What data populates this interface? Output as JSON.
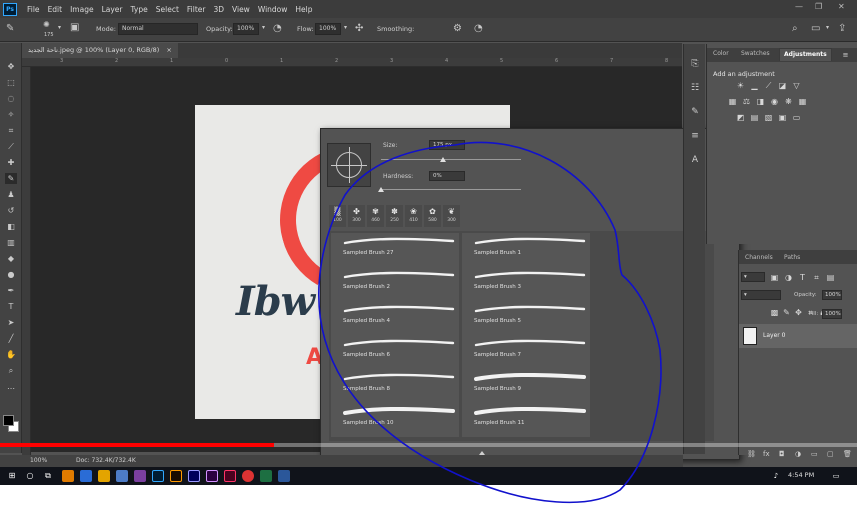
{
  "app": {
    "logo": "Ps",
    "menu": [
      "File",
      "Edit",
      "Image",
      "Layer",
      "Type",
      "Select",
      "Filter",
      "3D",
      "View",
      "Window",
      "Help"
    ]
  },
  "options_bar": {
    "brush_size": "175",
    "mode_label": "Mode:",
    "mode_value": "Normal",
    "opacity_label": "Opacity:",
    "opacity_value": "100%",
    "flow_label": "Flow:",
    "flow_value": "100%",
    "smoothing_label": "Smoothing:"
  },
  "document": {
    "tab_title": "ناحة الجديد.jpeg @ 100% (Layer 0, RGB/8)",
    "tab_close": "×",
    "ruler_numbers": [
      "3",
      "2",
      "1",
      "0",
      "1",
      "2",
      "3",
      "4",
      "5",
      "6",
      "7",
      "8"
    ],
    "logo_text": "Ibw",
    "logo_sub": "A"
  },
  "brush_picker": {
    "size_label": "Size:",
    "size_value": "175 px",
    "hardness_label": "Hardness:",
    "hardness_value": "0%",
    "size_level": 0.44,
    "hardness_level": 0.0,
    "tips": [
      "100",
      "300",
      "460",
      "250",
      "410",
      "580",
      "300"
    ],
    "brushes": [
      {
        "name": "Sampled Brush 27"
      },
      {
        "name": "Sampled Brush 1"
      },
      {
        "name": "Sampled Brush 2"
      },
      {
        "name": "Sampled Brush 3"
      },
      {
        "name": "Sampled Brush 4"
      },
      {
        "name": "Sampled Brush 5"
      },
      {
        "name": "Sampled Brush 6"
      },
      {
        "name": "Sampled Brush 7"
      },
      {
        "name": "Sampled Brush 8"
      },
      {
        "name": "Sampled Brush 9"
      },
      {
        "name": "Sampled Brush 10"
      },
      {
        "name": "Sampled Brush 11"
      }
    ]
  },
  "panels": {
    "top_tabs": [
      "Color",
      "Swatches",
      "Adjustments"
    ],
    "active_top_tab": "Adjustments",
    "adjustments_title": "Add an adjustment",
    "layer_tabs": [
      "Channels",
      "Paths"
    ],
    "opacity_label": "Opacity:",
    "opacity_value": "100%",
    "fill_label": "Fill:",
    "fill_value": "100%",
    "layer_name": "Layer 0"
  },
  "status": {
    "zoom": "100%",
    "doc": "Doc: 732.4K/732.4K"
  },
  "video": {
    "progress": 0.32
  },
  "taskbar": {
    "time": "4:54 PM"
  },
  "colors": {
    "accent_red": "#ef4a43",
    "logo_navy": "#2b3c4b",
    "annotation_blue": "#1111cc",
    "video_red": "#ff0000"
  }
}
